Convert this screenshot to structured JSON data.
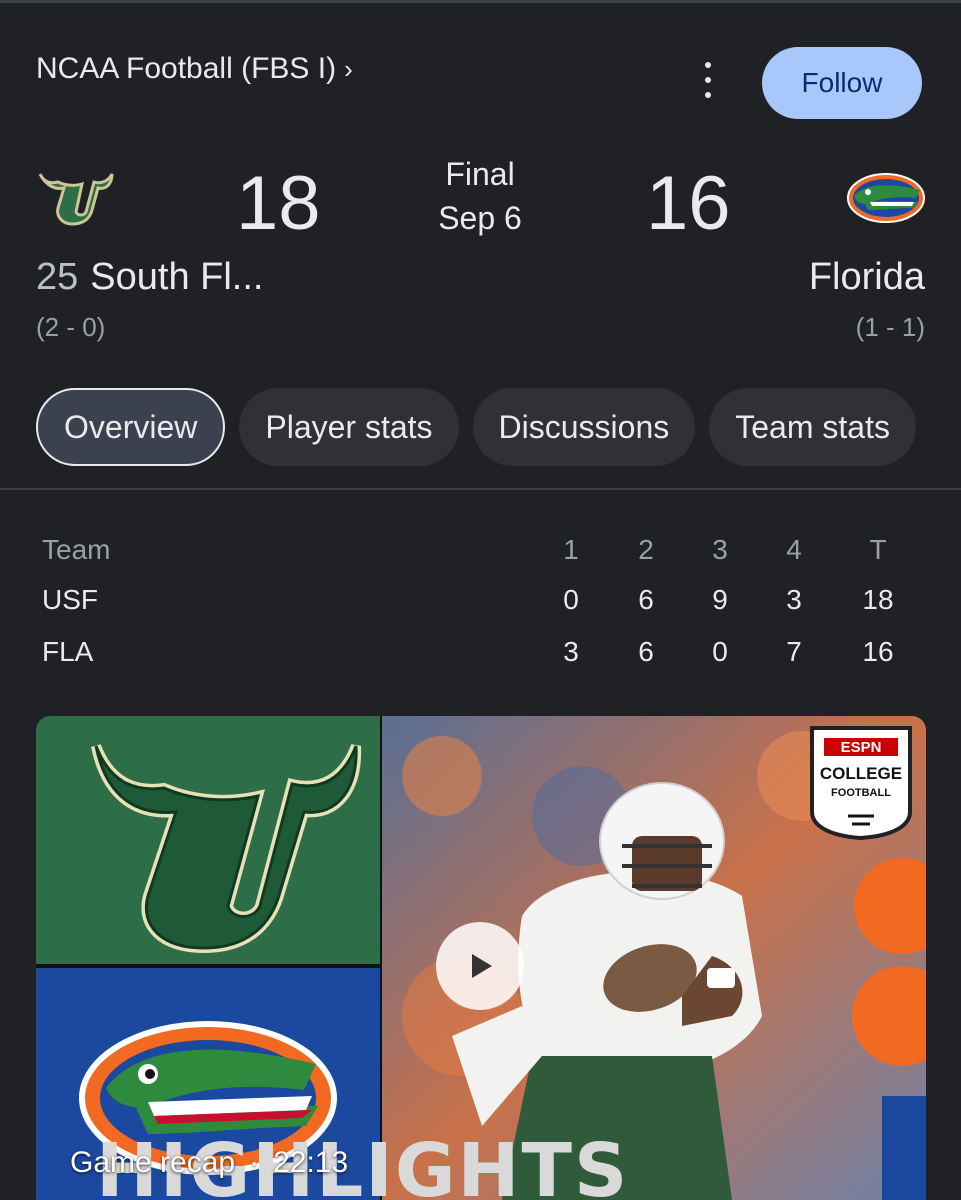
{
  "header": {
    "league": "NCAA Football (FBS I)",
    "league_chevron": "›",
    "menu_icon": "more-vert-icon",
    "follow_label": "Follow"
  },
  "game": {
    "status": "Final",
    "date": "Sep 6",
    "home": {
      "rank": "25",
      "name": "South Fl...",
      "score": "18",
      "record": "(2 - 0)",
      "logo_icon": "usf-bulls-logo"
    },
    "away": {
      "name": "Florida",
      "score": "16",
      "record": "(1 - 1)",
      "logo_icon": "florida-gators-logo"
    }
  },
  "tabs": [
    {
      "label": "Overview",
      "active": true
    },
    {
      "label": "Player stats",
      "active": false
    },
    {
      "label": "Discussions",
      "active": false
    },
    {
      "label": "Team stats",
      "active": false
    }
  ],
  "linescore": {
    "headers": [
      "Team",
      "1",
      "2",
      "3",
      "4",
      "T"
    ],
    "rows": [
      {
        "team": "USF",
        "q": [
          "0",
          "6",
          "9",
          "3"
        ],
        "total": "18"
      },
      {
        "team": "FLA",
        "q": [
          "3",
          "6",
          "0",
          "7"
        ],
        "total": "16"
      }
    ]
  },
  "video": {
    "title": "Game recap",
    "separator": "·",
    "duration": "22:13",
    "overlay_text": "HIGHLIGHTS",
    "badge_espn": "ESPN",
    "badge_line1": "COLLEGE",
    "badge_line2": "FOOTBALL",
    "play_icon": "play-icon"
  },
  "colors": {
    "background": "#202124",
    "follow_bg": "#a8c7fa",
    "usf_green": "#2d6e48",
    "gator_blue": "#1b49a0",
    "gator_orange": "#f26a21"
  }
}
